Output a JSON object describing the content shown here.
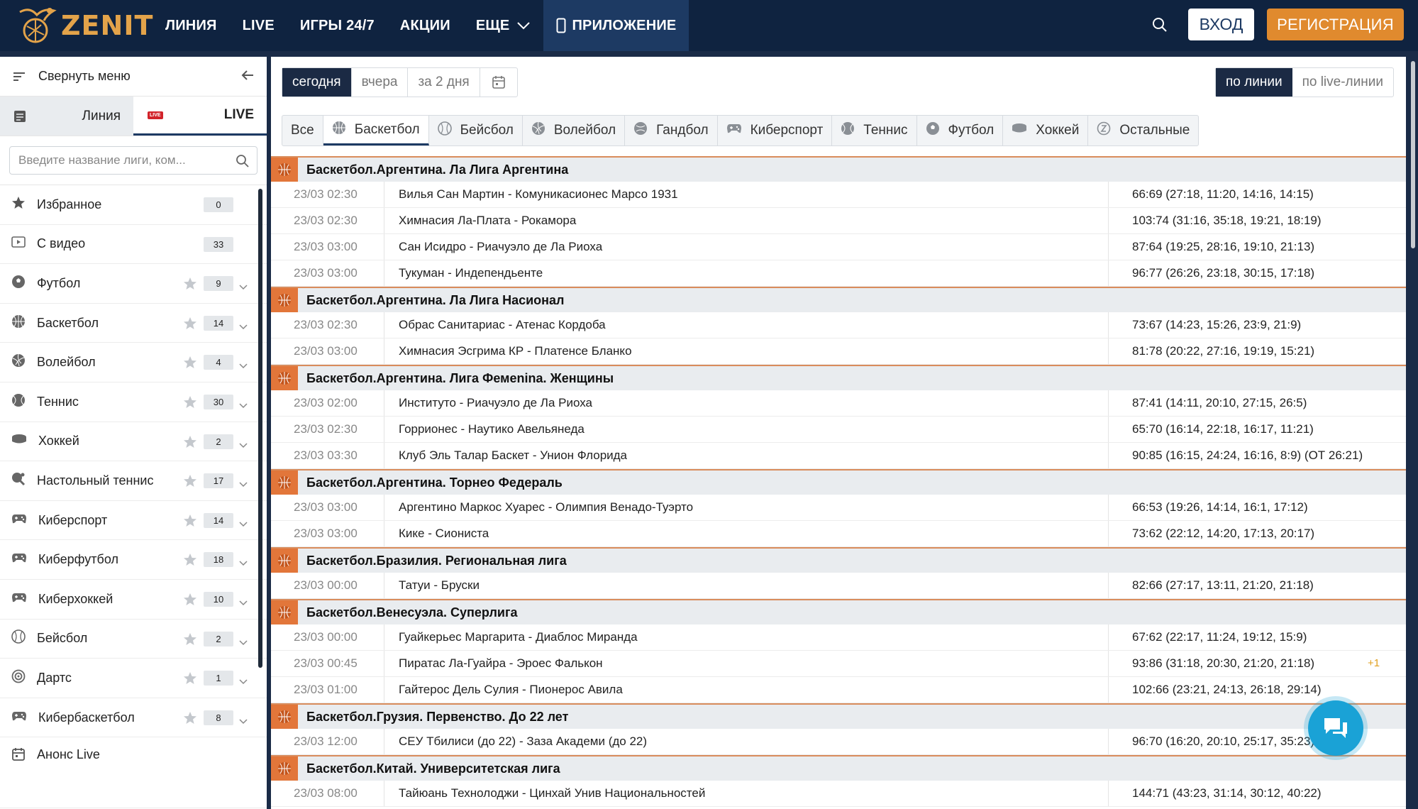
{
  "header": {
    "logo_text": "ZENIT",
    "nav": [
      "ЛИНИЯ",
      "LIVE",
      "ИГРЫ 24/7",
      "АКЦИИ",
      "ЕЩЕ",
      "ПРИЛОЖЕНИЕ"
    ],
    "login": "ВХОД",
    "register": "РЕГИСТРАЦИЯ"
  },
  "sidebar": {
    "collapse": "Свернуть меню",
    "tab_line": "Линия",
    "tab_live": "LIVE",
    "live_badge": "LIVE",
    "search_placeholder": "Введите название лиги, ком...",
    "items": [
      {
        "name": "Избранное",
        "count": "0",
        "icon": "star-icon"
      },
      {
        "name": "С видео",
        "count": "33",
        "icon": "video-icon"
      },
      {
        "name": "Футбол",
        "count": "9",
        "icon": "football-icon"
      },
      {
        "name": "Баскетбол",
        "count": "14",
        "icon": "basketball-icon"
      },
      {
        "name": "Волейбол",
        "count": "4",
        "icon": "volleyball-icon"
      },
      {
        "name": "Теннис",
        "count": "30",
        "icon": "tennis-icon"
      },
      {
        "name": "Хоккей",
        "count": "2",
        "icon": "hockey-icon"
      },
      {
        "name": "Настольный теннис",
        "count": "17",
        "icon": "table-tennis-icon"
      },
      {
        "name": "Киберспорт",
        "count": "14",
        "icon": "gamepad-icon"
      },
      {
        "name": "Киберфутбол",
        "count": "18",
        "icon": "gamepad-icon"
      },
      {
        "name": "Киберхоккей",
        "count": "10",
        "icon": "gamepad-icon"
      },
      {
        "name": "Бейсбол",
        "count": "2",
        "icon": "baseball-icon"
      },
      {
        "name": "Дартс",
        "count": "1",
        "icon": "darts-icon"
      },
      {
        "name": "Кибербаскетбол",
        "count": "8",
        "icon": "gamepad-icon"
      }
    ],
    "anons": "Анонс Live"
  },
  "filters": {
    "dates": [
      "сегодня",
      "вчера",
      "за 2 дня"
    ],
    "modes": [
      "по линии",
      "по live-линии"
    ],
    "sports": [
      "Все",
      "Баскетбол",
      "Бейсбол",
      "Волейбол",
      "Гандбол",
      "Киберспорт",
      "Теннис",
      "Футбол",
      "Хоккей",
      "Остальные"
    ]
  },
  "leagues": [
    {
      "name": "Баскетбол.Аргентина. Ла Лига Аргентина",
      "matches": [
        {
          "time": "23/03 02:30",
          "teams": "Вилья Сан Мартин - Комуникасионес Марсо 1931",
          "score": "66:69 (27:18, 11:20, 14:16, 14:15)"
        },
        {
          "time": "23/03 02:30",
          "teams": "Химнасия Ла-Плата - Рокамора",
          "score": "103:74 (31:16, 35:18, 19:21, 18:19)"
        },
        {
          "time": "23/03 03:00",
          "teams": "Сан Исидро - Риачуэло де Ла Риоха",
          "score": "87:64 (19:25, 28:16, 19:10, 21:13)"
        },
        {
          "time": "23/03 03:00",
          "teams": "Тукуман - Индепендьенте",
          "score": "96:77 (26:26, 23:18, 30:15, 17:18)"
        }
      ]
    },
    {
      "name": "Баскетбол.Аргентина. Ла Лига Насионал",
      "matches": [
        {
          "time": "23/03 02:30",
          "teams": "Обрас Санитариас - Атенас Кордоба",
          "score": "73:67 (14:23, 15:26, 23:9, 21:9)"
        },
        {
          "time": "23/03 03:00",
          "teams": "Химнасия Эсгрима КР - Платенсе Бланко",
          "score": "81:78 (20:22, 27:16, 19:19, 15:21)"
        }
      ]
    },
    {
      "name": "Баскетбол.Аргентина. Лига Фемenina. Женщины",
      "matches": [
        {
          "time": "23/03 02:00",
          "teams": "Институто - Риачуэло де Ла Риоха",
          "score": "87:41 (14:11, 20:10, 27:15, 26:5)"
        },
        {
          "time": "23/03 02:30",
          "teams": "Горрионес - Наутико Авельянеда",
          "score": "65:70 (16:14, 22:18, 16:17, 11:21)"
        },
        {
          "time": "23/03 03:30",
          "teams": "Клуб Эль Талар Баскет - Унион Флорида",
          "score": "90:85 (16:15, 24:24, 16:16, 8:9) (ОТ 26:21)"
        }
      ]
    },
    {
      "name": "Баскетбол.Аргентина. Торнео Федераль",
      "matches": [
        {
          "time": "23/03 03:00",
          "teams": "Аргентино Маркос Хуарес - Олимпия Венадо-Туэрто",
          "score": "66:53 (19:26, 14:14, 16:1, 17:12)"
        },
        {
          "time": "23/03 03:00",
          "teams": "Кике - Сиониста",
          "score": "73:62 (22:12, 14:20, 17:13, 20:17)"
        }
      ]
    },
    {
      "name": "Баскетбол.Бразилия. Региональная лига",
      "matches": [
        {
          "time": "23/03 00:00",
          "teams": "Татуи - Бруски",
          "score": "82:66 (27:17, 13:11, 21:20, 21:18)"
        }
      ]
    },
    {
      "name": "Баскетбол.Венесуэла. Суперлига",
      "matches": [
        {
          "time": "23/03 00:00",
          "teams": "Гуайкерьес Маргарита - Диаблос Миранда",
          "score": "67:62 (22:17, 11:24, 19:12, 15:9)"
        },
        {
          "time": "23/03 00:45",
          "teams": "Пиратас Ла-Гуайра - Эроес Фалькон",
          "score": "93:86 (31:18, 20:30, 21:20, 21:18)",
          "extra": "+1"
        },
        {
          "time": "23/03 01:00",
          "teams": "Гайтерос Дель Сулия - Пионерос Авила",
          "score": "102:66 (23:21, 24:13, 26:18, 29:14)"
        }
      ]
    },
    {
      "name": "Баскетбол.Грузия. Первенство. До 22 лет",
      "matches": [
        {
          "time": "23/03 12:00",
          "teams": "СЕУ Тбилиси (до 22) - Заза Академи (до 22)",
          "score": "96:70 (16:20, 20:10, 25:17, 35:23)"
        }
      ]
    },
    {
      "name": "Баскетбол.Китай. Университетская лига",
      "matches": [
        {
          "time": "23/03 08:00",
          "teams": "Тайюань Технолоджи - Цинхай Унив Национальностей",
          "score": "144:71 (43:23, 31:14, 30:12, 40:22)"
        }
      ]
    }
  ]
}
